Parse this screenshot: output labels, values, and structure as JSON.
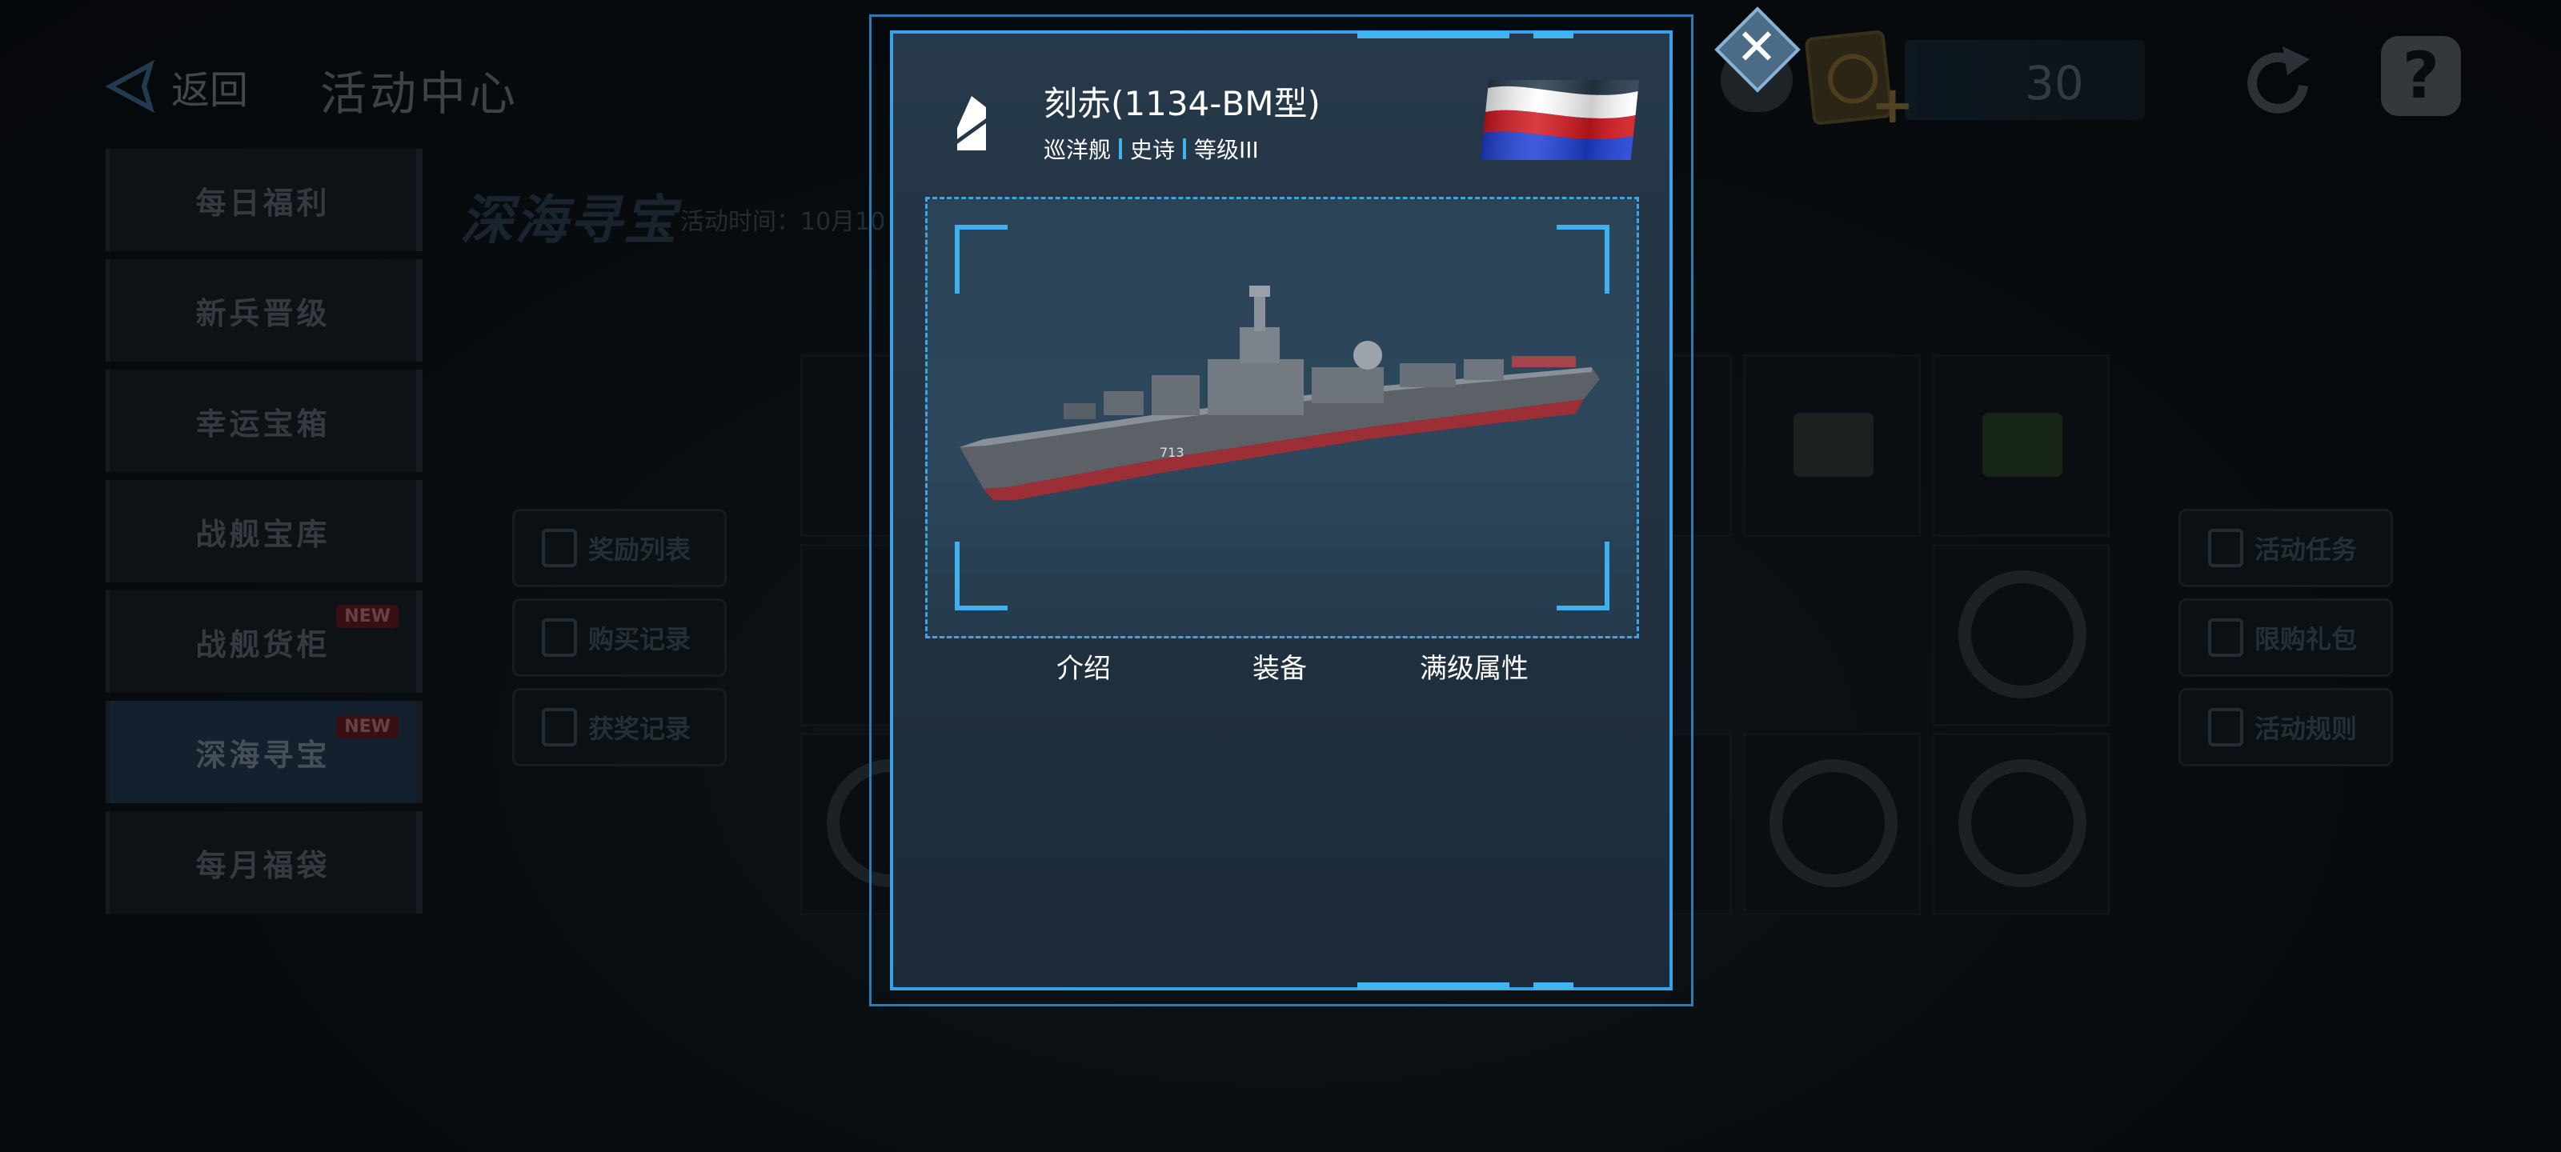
{
  "topbar": {
    "back_label": "返回",
    "title": "活动中心",
    "resource_value": "30"
  },
  "sidebar": {
    "items": [
      {
        "label": "每日福利",
        "badge": ""
      },
      {
        "label": "新兵晋级",
        "badge": ""
      },
      {
        "label": "幸运宝箱",
        "badge": ""
      },
      {
        "label": "战舰宝库",
        "badge": ""
      },
      {
        "label": "战舰货柜",
        "badge": "NEW"
      },
      {
        "label": "深海寻宝",
        "badge": "NEW"
      },
      {
        "label": "每月福袋",
        "badge": ""
      }
    ],
    "active_index": 5
  },
  "content": {
    "title": "深海寻宝",
    "time_text": "活动时间：10月10"
  },
  "left_buttons": [
    "奖励列表",
    "购买记录",
    "获奖记录"
  ],
  "right_buttons": [
    "活动任务",
    "限购礼包",
    "活动规则"
  ],
  "modal": {
    "ship_name": "刻赤(1134-BM型)",
    "tags": [
      "巡洋舰",
      "史诗",
      "等级III"
    ],
    "flag_country": "Russia",
    "flag_colors": [
      "#ffffff",
      "#1e3fd6",
      "#d4171f"
    ],
    "tabs": [
      "介绍",
      "装备",
      "满级属性"
    ],
    "close_label": "✕",
    "accent": "#37a3e6"
  }
}
